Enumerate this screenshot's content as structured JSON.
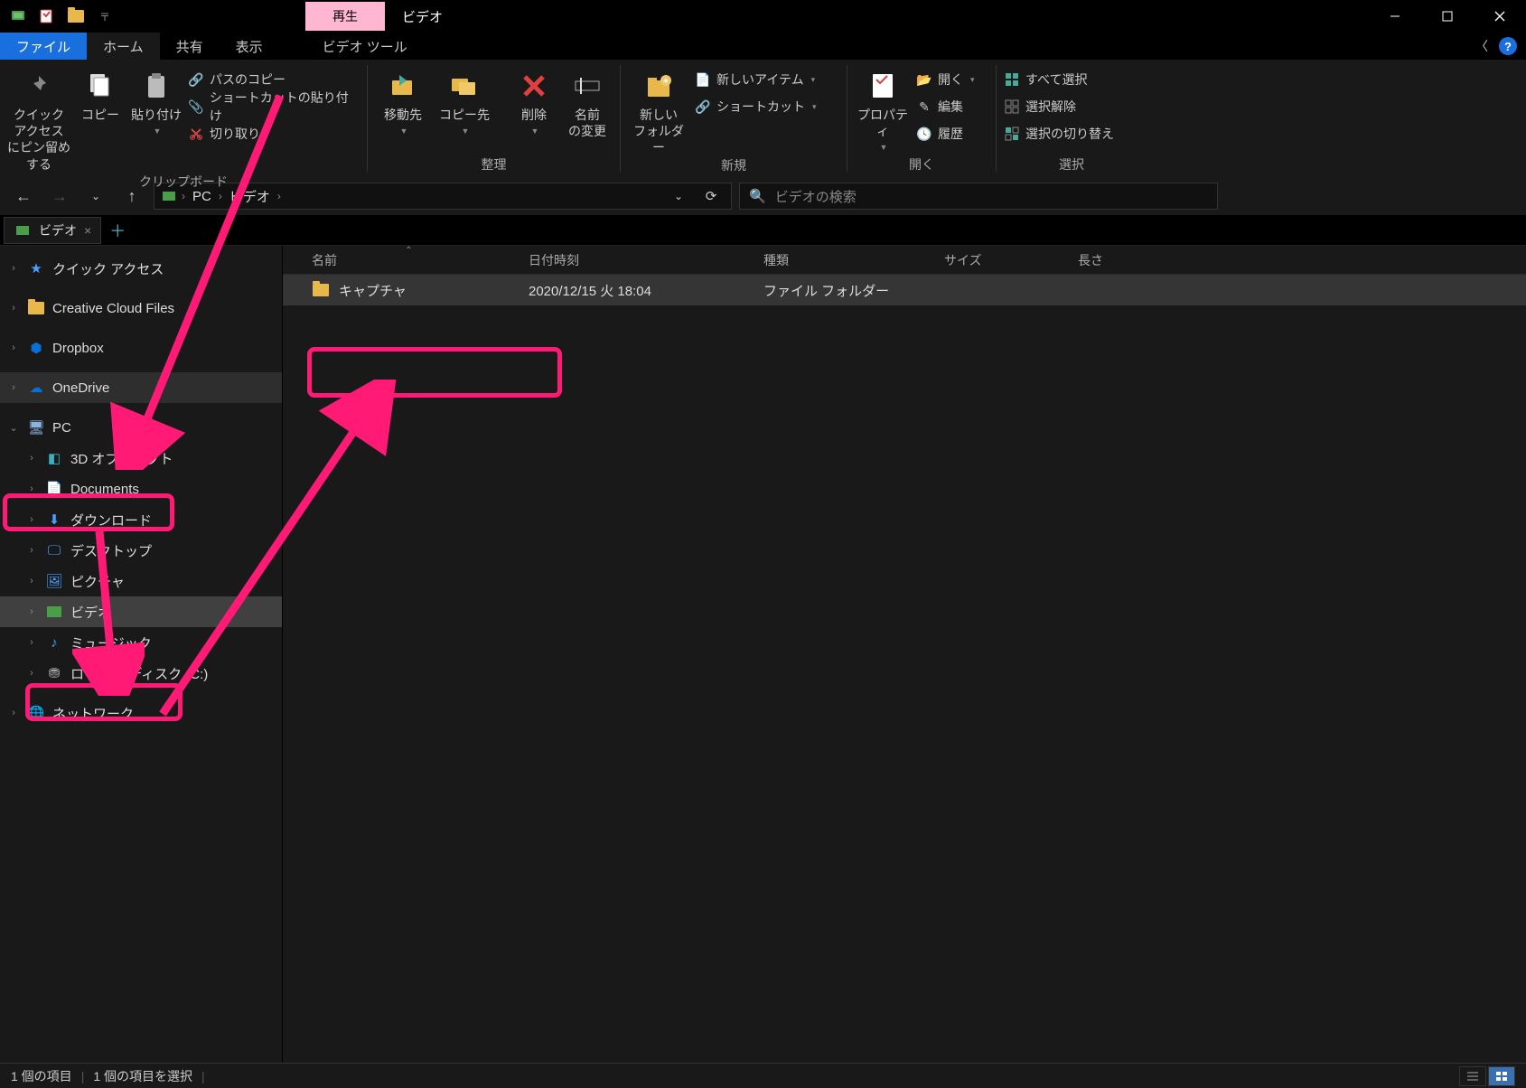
{
  "titlebar": {
    "context_tab": "再生",
    "title": "ビデオ"
  },
  "tabs": {
    "file": "ファイル",
    "home": "ホーム",
    "share": "共有",
    "view": "表示",
    "video_tools": "ビデオ ツール"
  },
  "ribbon": {
    "pin": "クイック アクセス\nにピン留めする",
    "copy": "コピー",
    "paste": "貼り付け",
    "copy_path": "パスのコピー",
    "paste_shortcut": "ショートカットの貼り付け",
    "cut": "切り取り",
    "group_clipboard": "クリップボード",
    "move_to": "移動先",
    "copy_to": "コピー先",
    "delete": "削除",
    "rename": "名前\nの変更",
    "group_organize": "整理",
    "new_folder": "新しい\nフォルダー",
    "new_item": "新しいアイテム",
    "shortcut": "ショートカット",
    "group_new": "新規",
    "properties": "プロパティ",
    "open": "開く",
    "edit": "編集",
    "history": "履歴",
    "group_open": "開く",
    "select_all": "すべて選択",
    "select_none": "選択解除",
    "invert": "選択の切り替え",
    "group_select": "選択"
  },
  "breadcrumb": {
    "pc": "PC",
    "videos": "ビデオ"
  },
  "search": {
    "placeholder": "ビデオの検索"
  },
  "file_tab": {
    "label": "ビデオ"
  },
  "sidebar": {
    "quick_access": "クイック アクセス",
    "creative_cloud": "Creative Cloud Files",
    "dropbox": "Dropbox",
    "onedrive": "OneDrive",
    "pc": "PC",
    "objects_3d": "3D オブジェクト",
    "documents": "Documents",
    "downloads": "ダウンロード",
    "desktop": "デスクトップ",
    "pictures": "ピクチャ",
    "videos": "ビデオ",
    "music": "ミュージック",
    "local_disk": "ローカル ディスク (C:)",
    "network": "ネットワーク"
  },
  "columns": {
    "name": "名前",
    "date": "日付時刻",
    "type": "種類",
    "size": "サイズ",
    "length": "長さ"
  },
  "files": [
    {
      "name": "キャプチャ",
      "date": "2020/12/15 火 18:04",
      "type": "ファイル フォルダー",
      "size": "",
      "length": ""
    }
  ],
  "status": {
    "count": "1 個の項目",
    "selected": "1 個の項目を選択"
  }
}
